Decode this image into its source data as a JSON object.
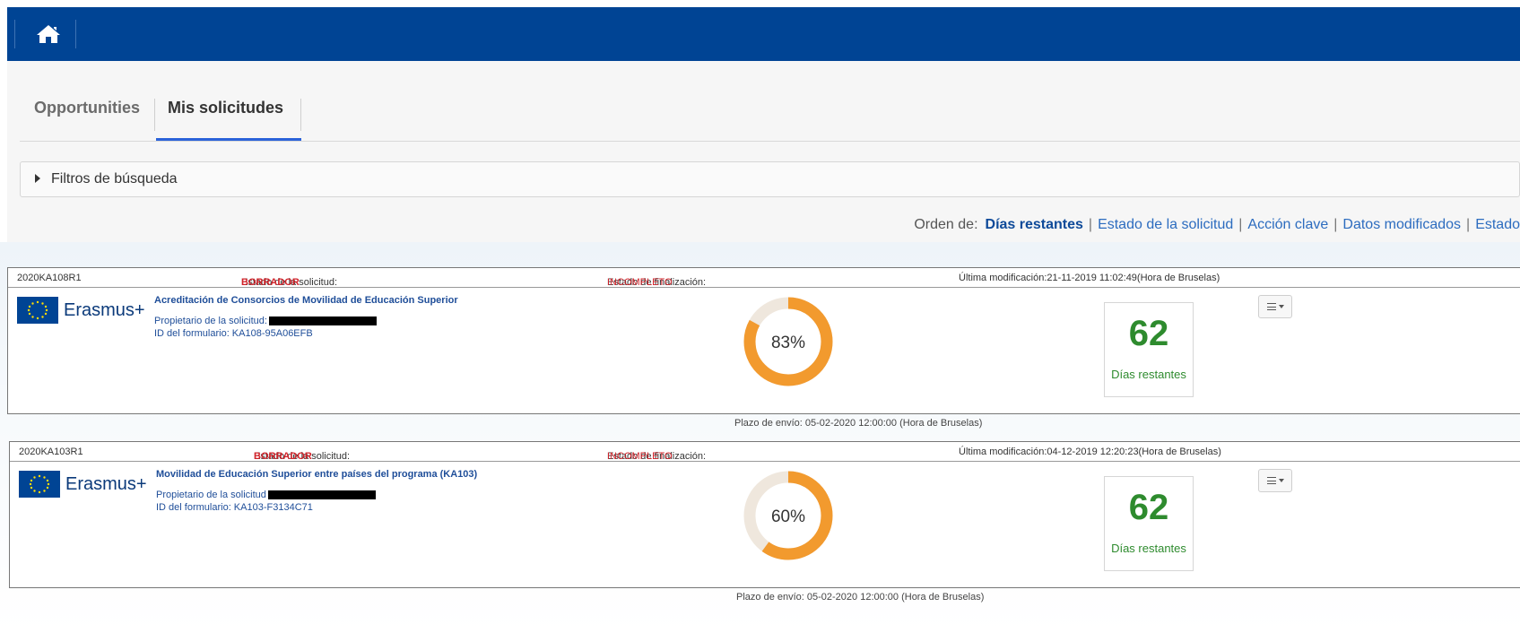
{
  "topbar": {
    "home_icon": "home-icon"
  },
  "tabs": [
    {
      "label": "Opportunities",
      "active": false
    },
    {
      "label": "Mis solicitudes",
      "active": true
    }
  ],
  "filters": {
    "label": "Filtros de búsqueda"
  },
  "sort": {
    "prefix": "Orden de:",
    "options": [
      "Días restantes",
      "Estado de la solicitud",
      "Acción clave",
      "Datos modificados",
      "Estado"
    ],
    "active": "Días restantes"
  },
  "colors": {
    "topbar": "#004494",
    "progress": "#f29a2e",
    "progress_track": "#efe7dd",
    "days": "#2e8b2e",
    "status_red": "#d2232a"
  },
  "applications": [
    {
      "code": "2020KA108R1",
      "status_label": "Estado de la solicitud:",
      "status_value": "BORRADOR",
      "completion_label": "Estado de finalización:",
      "completion_value": "INCOMPLETO",
      "modified": "Última modificación:21-11-2019 11:02:49(Hora de Bruselas)",
      "logo_text": "Erasmus+",
      "title": "Acreditación de Consorcios de Movilidad de Educación Superior",
      "owner_label": "Propietario de la solicitud:",
      "form_id": "ID del formulario: KA108-95A06EFB",
      "progress": 83,
      "progress_text": "83%",
      "deadline": "Plazo de envío: 05-02-2020 12:00:00 (Hora de Bruselas)",
      "days": "62",
      "days_label": "Días restantes"
    },
    {
      "code": "2020KA103R1",
      "status_label": "Estado de la solicitud:",
      "status_value": "BORRADOR",
      "completion_label": "Estado de finalización:",
      "completion_value": "INCOMPLETO",
      "modified": "Última modificación:04-12-2019 12:20:23(Hora de Bruselas)",
      "logo_text": "Erasmus+",
      "title": "Movilidad de Educación Superior entre países del programa (KA103)",
      "owner_label": "Propietario de la solicitud",
      "form_id": "ID del formulario: KA103-F3134C71",
      "progress": 60,
      "progress_text": "60%",
      "deadline": "Plazo de envío: 05-02-2020 12:00:00 (Hora de Bruselas)",
      "days": "62",
      "days_label": "Días restantes"
    }
  ]
}
